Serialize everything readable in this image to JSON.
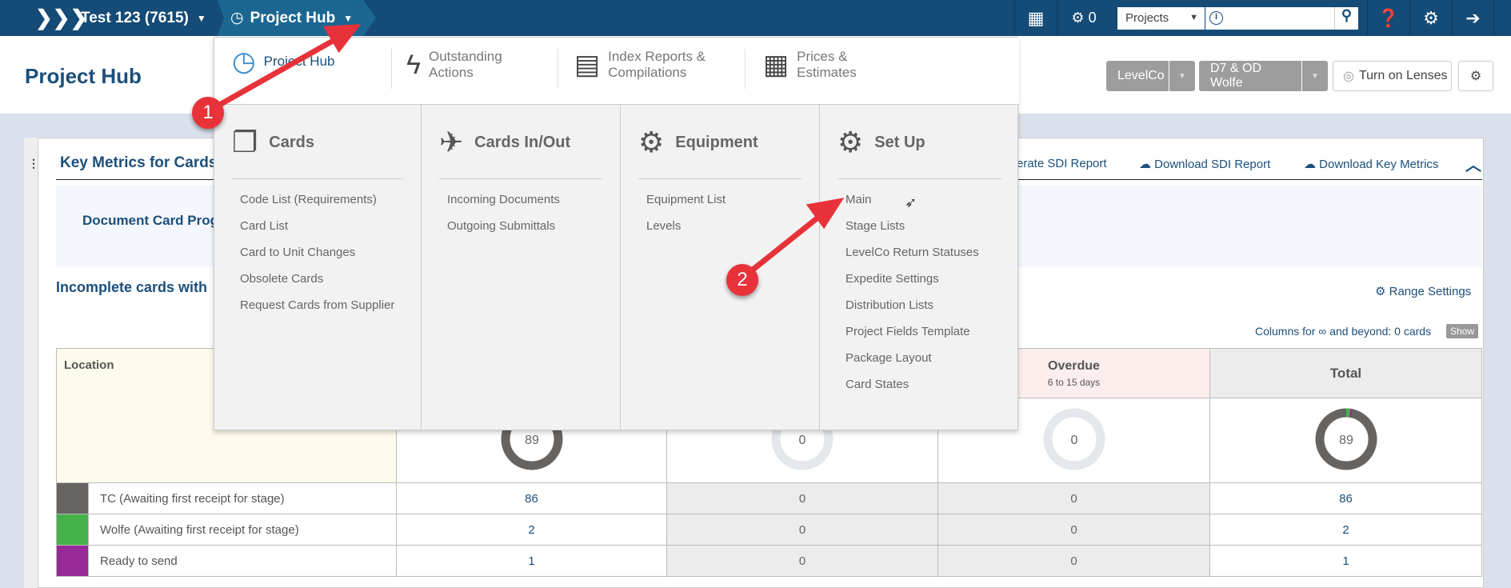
{
  "topnav": {
    "home_icon": "chevrons-icon",
    "project": "Test 123 (7615)",
    "hub": "Project Hub",
    "notif_count": "0",
    "search_scope": "Projects",
    "search_placeholder": ""
  },
  "header": {
    "title": "Project Hub",
    "btn1": "LevelCo",
    "btn2": "D7 & OD Wolfe",
    "lenses": "Turn on Lenses"
  },
  "panel": {
    "title": "Key Metrics for Cards",
    "generate": "erate SDI Report",
    "download_sdi": "Download SDI Report",
    "download_metrics": "Download Key Metrics",
    "progress_heading": "Document Card Prog",
    "incomplete": "Incomplete cards with",
    "range_settings": "Range Settings",
    "columns_note": "Columns for ∞ and beyond: 0 cards",
    "show": "Show"
  },
  "table": {
    "location": "Location",
    "overdue": "Overdue",
    "overdue_sub": "6 to 15 days",
    "total": "Total",
    "donuts": [
      "89",
      "0",
      "0",
      "89"
    ],
    "rows": [
      {
        "label": "TC (Awaiting first receipt for stage)",
        "color": "#676360",
        "values": [
          "86",
          "0",
          "0",
          "86"
        ]
      },
      {
        "label": "Wolfe (Awaiting first receipt for stage)",
        "color": "#45b14a",
        "values": [
          "2",
          "0",
          "0",
          "2"
        ]
      },
      {
        "label": "Ready to send",
        "color": "#982a98",
        "values": [
          "1",
          "0",
          "0",
          "1"
        ]
      }
    ]
  },
  "menu": {
    "top": [
      "Project Hub",
      "Outstanding Actions",
      "Index Reports & Compilations",
      "Prices & Estimates"
    ],
    "columns": [
      {
        "title": "Cards",
        "items": [
          "Code List (Requirements)",
          "Card List",
          "Card to Unit Changes",
          "Obsolete Cards",
          "Request Cards from Supplier"
        ]
      },
      {
        "title": "Cards In/Out",
        "items": [
          "Incoming Documents",
          "Outgoing Submittals"
        ]
      },
      {
        "title": "Equipment",
        "items": [
          "Equipment List",
          "Levels"
        ]
      },
      {
        "title": "Set Up",
        "items": [
          "Main",
          "Stage Lists",
          "LevelCo Return Statuses",
          "Expedite Settings",
          "Distribution Lists",
          "Project Fields Template",
          "Package Layout",
          "Card States"
        ]
      }
    ]
  },
  "annotations": [
    "1",
    "2"
  ],
  "colors": {
    "nav": "#144b77",
    "accent": "#1c4f7c",
    "badge": "#e8323a"
  }
}
